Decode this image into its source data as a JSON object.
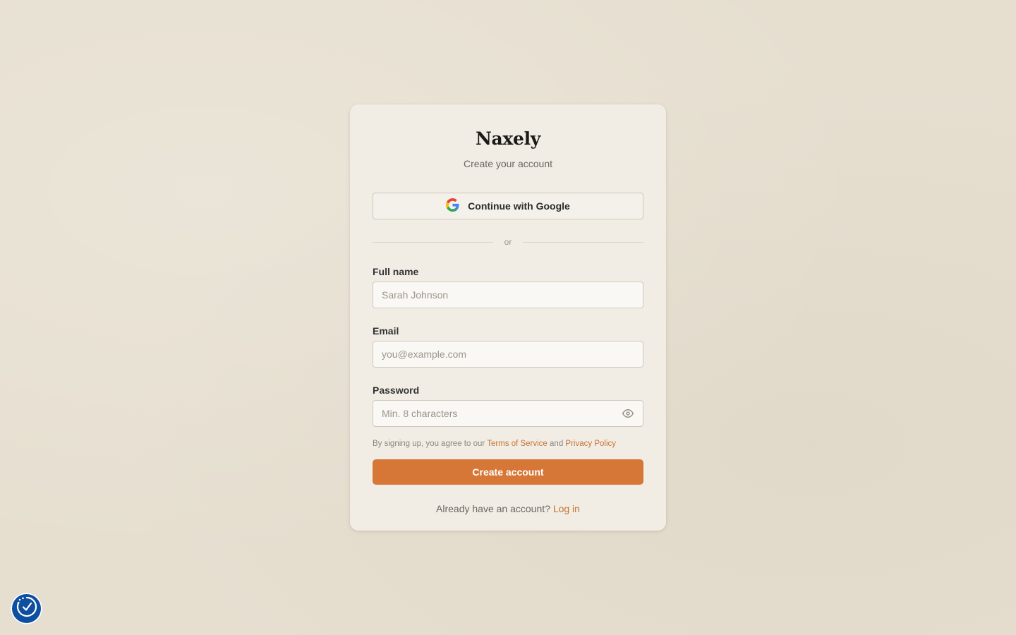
{
  "brand": "Naxely",
  "subtitle": "Create your account",
  "google_button": {
    "label": "Continue with Google",
    "icon": "google-logo-icon"
  },
  "divider": "or",
  "fields": {
    "full_name": {
      "label": "Full name",
      "placeholder": "Sarah Johnson"
    },
    "email": {
      "label": "Email",
      "placeholder": "you@example.com"
    },
    "password": {
      "label": "Password",
      "placeholder": "Min. 8 characters",
      "toggle_icon": "eye-icon"
    }
  },
  "terms": {
    "prefix": "By signing up, you agree to our",
    "tos": "Terms of Service",
    "and": "and",
    "privacy": "Privacy Policy"
  },
  "create_button": "Create account",
  "login": {
    "prompt": "Already have an account?",
    "link": "Log in"
  },
  "accessibility_icon": "accessibility-widget-icon",
  "colors": {
    "accent": "#d77737",
    "link": "#c77231",
    "background": "#e6dfd0",
    "card": "#f1ede5",
    "a11y": "#0e4fa0"
  }
}
